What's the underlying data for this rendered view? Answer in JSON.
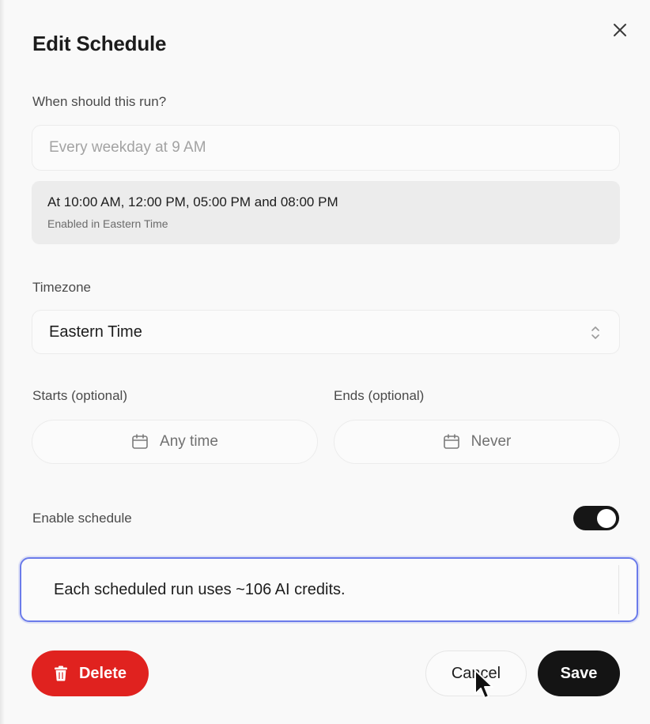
{
  "dialog": {
    "title": "Edit Schedule",
    "close_icon": "close-icon"
  },
  "schedule": {
    "label": "When should this run?",
    "placeholder": "Every weekday at 9 AM",
    "value": "",
    "preview_main": "At 10:00 AM, 12:00 PM, 05:00 PM and 08:00 PM",
    "preview_sub": "Enabled in Eastern Time"
  },
  "timezone": {
    "label": "Timezone",
    "selected": "Eastern Time",
    "icon": "chevron-up-down-icon"
  },
  "starts": {
    "label": "Starts (optional)",
    "value": "Any time",
    "icon": "calendar-icon"
  },
  "ends": {
    "label": "Ends (optional)",
    "value": "Never",
    "icon": "calendar-icon"
  },
  "enable": {
    "label": "Enable schedule",
    "on": true
  },
  "credits": {
    "text": "Each scheduled run uses ~106 AI credits."
  },
  "actions": {
    "delete_label": "Delete",
    "delete_icon": "trash-icon",
    "cancel_label": "Cancel",
    "save_label": "Save"
  },
  "colors": {
    "delete": "#e0221f",
    "primary": "#141414",
    "focus_ring": "#6b7bea"
  }
}
